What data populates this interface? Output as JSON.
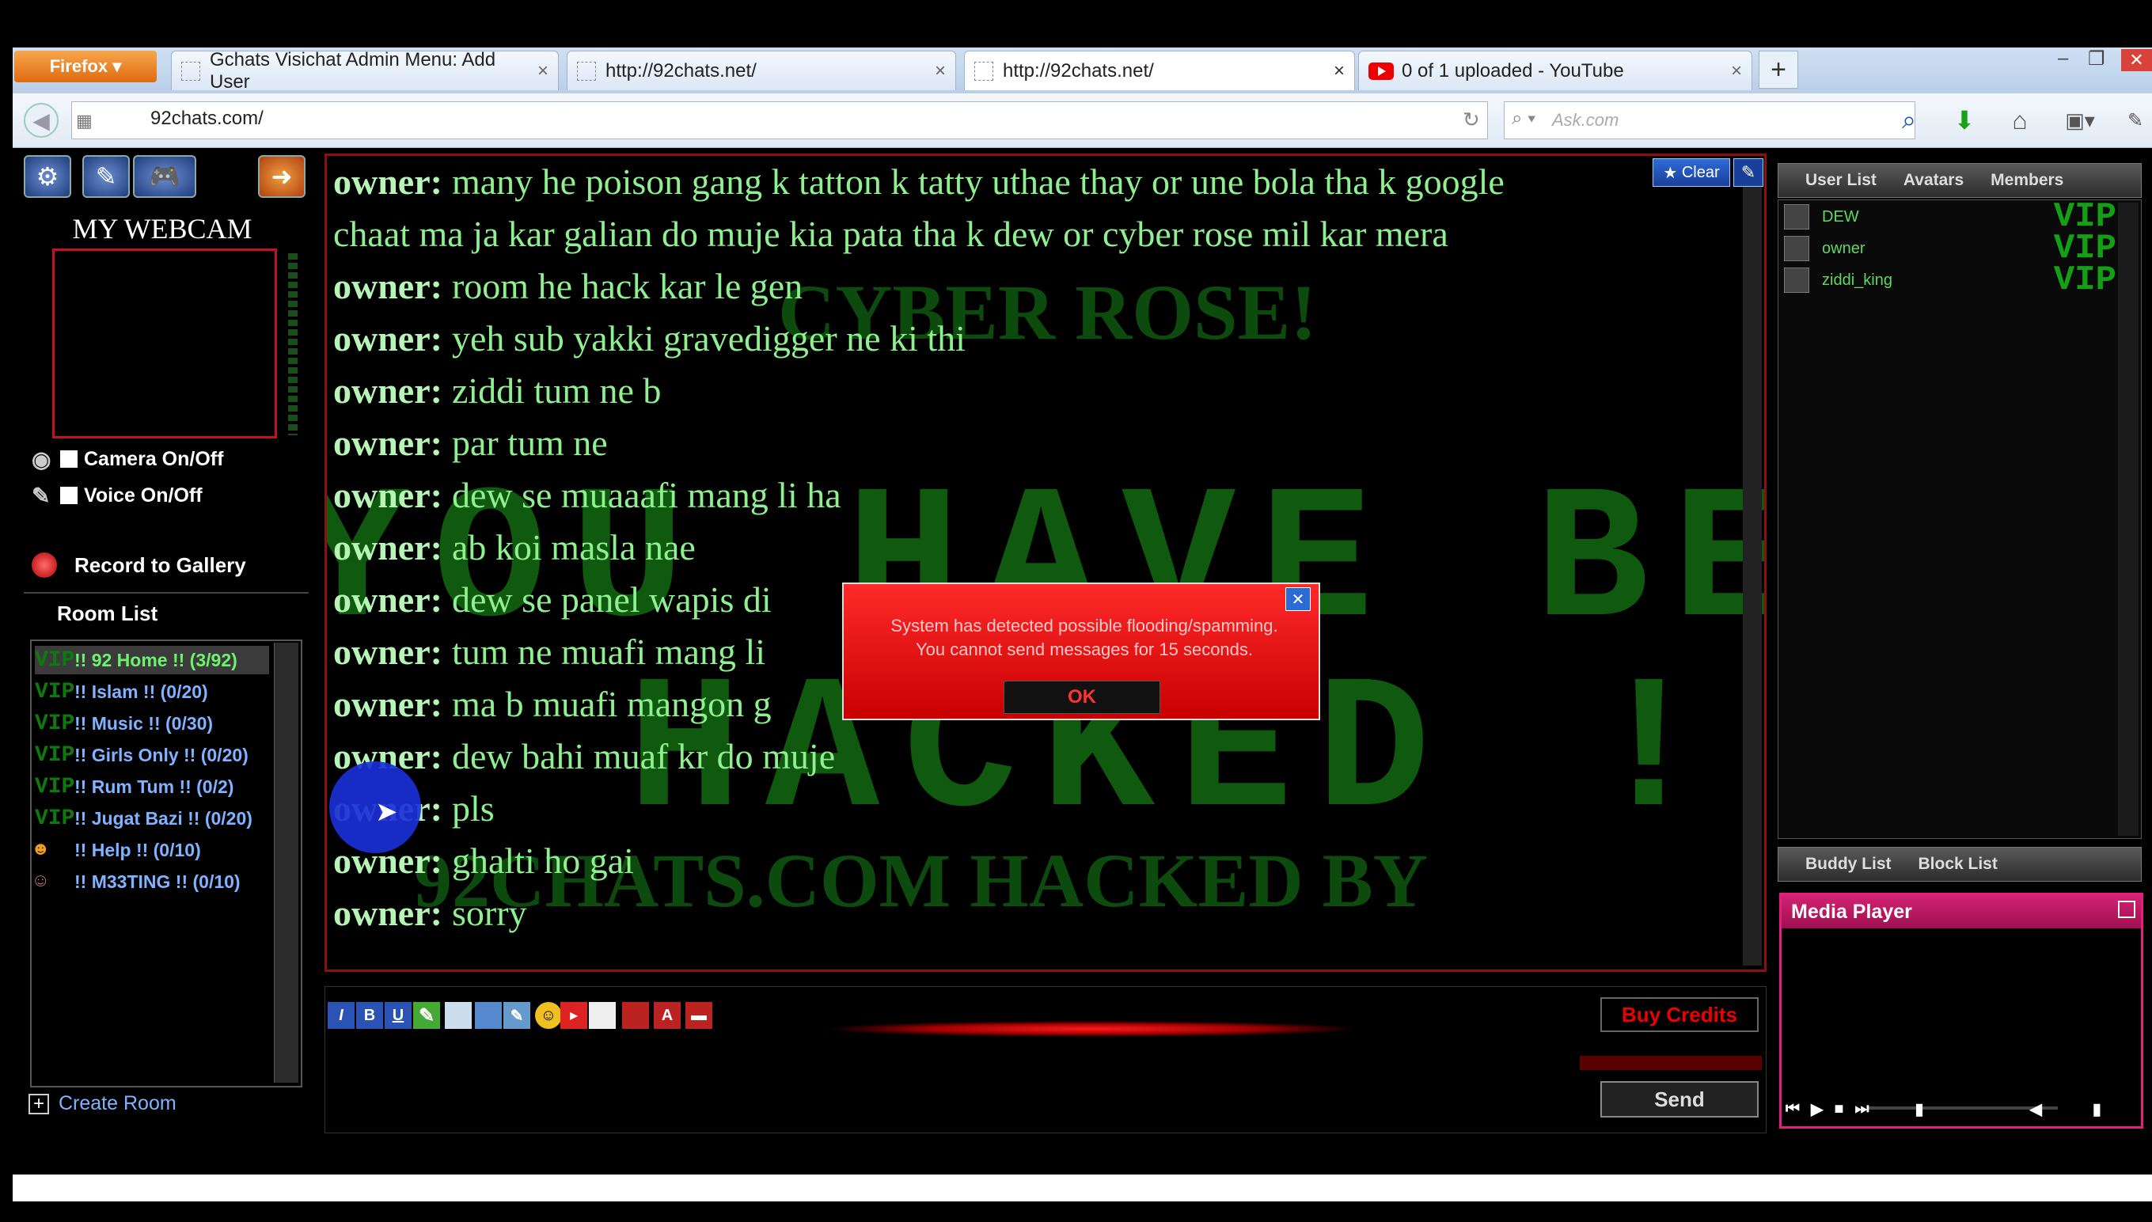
{
  "browser": {
    "menu_button": "Firefox",
    "tabs": [
      {
        "title": "Gchats Visichat Admin Menu: Add User"
      },
      {
        "title": "http://92chats.net/"
      },
      {
        "title": "http://92chats.net/"
      },
      {
        "title": "0 of 1 uploaded - YouTube"
      }
    ],
    "url": "92chats.com/",
    "search_placeholder": "Ask.com"
  },
  "left_panel": {
    "webcam_title": "MY WEBCAM",
    "camera_label": "Camera On/Off",
    "voice_label": "Voice On/Off",
    "record_label": "Record to Gallery",
    "room_list_title": "Room List",
    "rooms": [
      {
        "prefix": "VIP",
        "label": "!! 92 Home !! (3/92)"
      },
      {
        "prefix": "VIP",
        "label": "!! Islam !! (0/20)"
      },
      {
        "prefix": "VIP",
        "label": "!! Music !! (0/30)"
      },
      {
        "prefix": "VIP",
        "label": "!! Girls Only !! (0/20)"
      },
      {
        "prefix": "VIP",
        "label": "!! Rum Tum !! (0/2)"
      },
      {
        "prefix": "VIP",
        "label": "!! Jugat Bazi !! (0/20)"
      },
      {
        "prefix": "",
        "label": "!! Help !! (0/10)"
      },
      {
        "prefix": "",
        "label": "!! M33TING !! (0/10)"
      }
    ],
    "create_room": "Create Room"
  },
  "chat": {
    "clear_label": "Clear",
    "background_text": [
      "CYBER ROSE!",
      "YOU HAVE BEEN",
      "HACKED !",
      "92CHATS.COM HACKED BY"
    ],
    "messages": [
      {
        "user": "owner:",
        "text": "many he poison gang k tatton k tatty uthae thay or une bola tha k google"
      },
      {
        "user": "",
        "text": "chaat ma ja kar galian do muje kia pata tha k dew or cyber rose mil kar mera"
      },
      {
        "user": "owner:",
        "text": "room he hack kar le gen"
      },
      {
        "user": "owner:",
        "text": "yeh sub yakki gravedigger ne ki thi"
      },
      {
        "user": "owner:",
        "text": "ziddi tum ne b"
      },
      {
        "user": "owner:",
        "text": "par tum ne"
      },
      {
        "user": "owner:",
        "text": "dew se muaaafi mang li ha"
      },
      {
        "user": "owner:",
        "text": "ab koi masla nae"
      },
      {
        "user": "owner:",
        "text": "dew se panel wapis di"
      },
      {
        "user": "owner:",
        "text": "tum ne muafi mang li"
      },
      {
        "user": "owner:",
        "text": "ma b muafi mangon g"
      },
      {
        "user": "owner:",
        "text": "dew bahi muaf kr do muje"
      },
      {
        "user": "owner:",
        "text": "pls"
      },
      {
        "user": "owner:",
        "text": "ghalti ho gai"
      },
      {
        "user": "owner:",
        "text": "sorry"
      }
    ]
  },
  "dialog": {
    "line1": "System has detected possible flooding/spamming.",
    "line2": "You cannot send messages for 15 seconds.",
    "ok_label": "OK"
  },
  "input": {
    "buy_credits": "Buy Credits",
    "send": "Send"
  },
  "right_panel": {
    "tabs": [
      "User List",
      "Avatars",
      "Members"
    ],
    "users": [
      {
        "name": "DEW",
        "badge": "VIP"
      },
      {
        "name": "owner",
        "badge": "VIP"
      },
      {
        "name": "ziddi_king",
        "badge": "VIP"
      }
    ],
    "bottom_tabs": [
      "Buddy List",
      "Block List"
    ],
    "media_title": "Media Player"
  }
}
